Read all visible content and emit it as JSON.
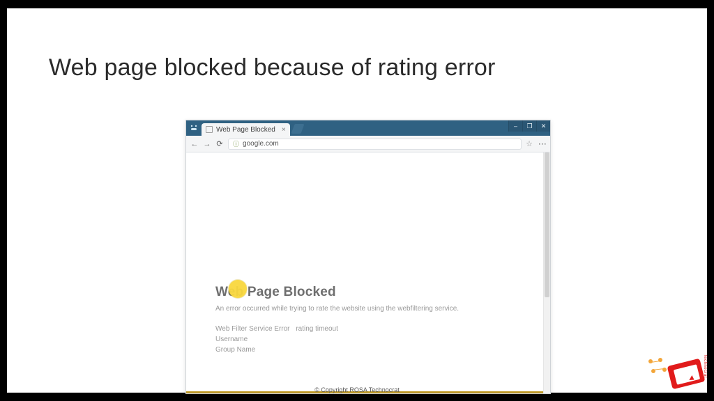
{
  "slide": {
    "title": "Web page blocked because of rating error",
    "copyright": "© Copyright ROSA Technocrat"
  },
  "browser": {
    "tab_label": "Web Page Blocked",
    "url": "google.com",
    "window": {
      "min": "–",
      "max": "❐",
      "close": "✕"
    },
    "nav": {
      "back": "←",
      "forward": "→",
      "reload": "⟳"
    },
    "url_prefix_icon": "ⓘ",
    "star": "☆",
    "menu": "⋮"
  },
  "blocked": {
    "heading": "Web Page Blocked",
    "desc": "An error occurred while trying to rate the website using the webfiltering service.",
    "l1_label": "Web Filter Service Error",
    "l1_value": "rating timeout",
    "l2": "Username",
    "l3": "Group Name"
  },
  "brand": {
    "text": "technocrat"
  }
}
